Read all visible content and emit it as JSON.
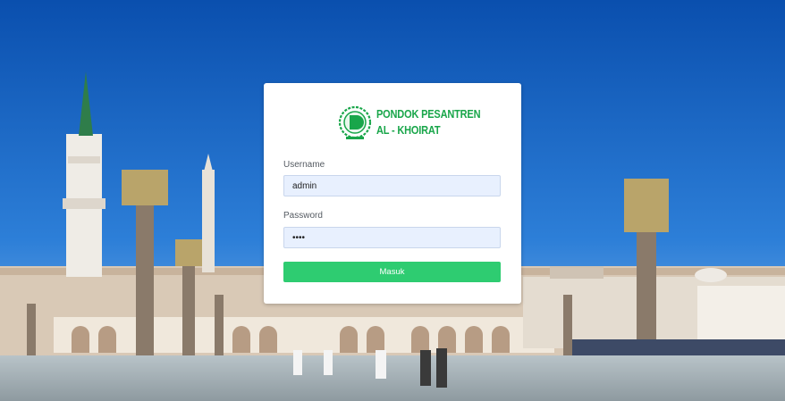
{
  "logo": {
    "line1": "PONDOK PESANTREN",
    "line2": "AL - KHOIRAT",
    "color": "#19a64a"
  },
  "form": {
    "username_label": "Username",
    "username_value": "admin",
    "password_label": "Password",
    "password_value": "1234",
    "submit_label": "Masuk",
    "button_color": "#2ecc71"
  }
}
